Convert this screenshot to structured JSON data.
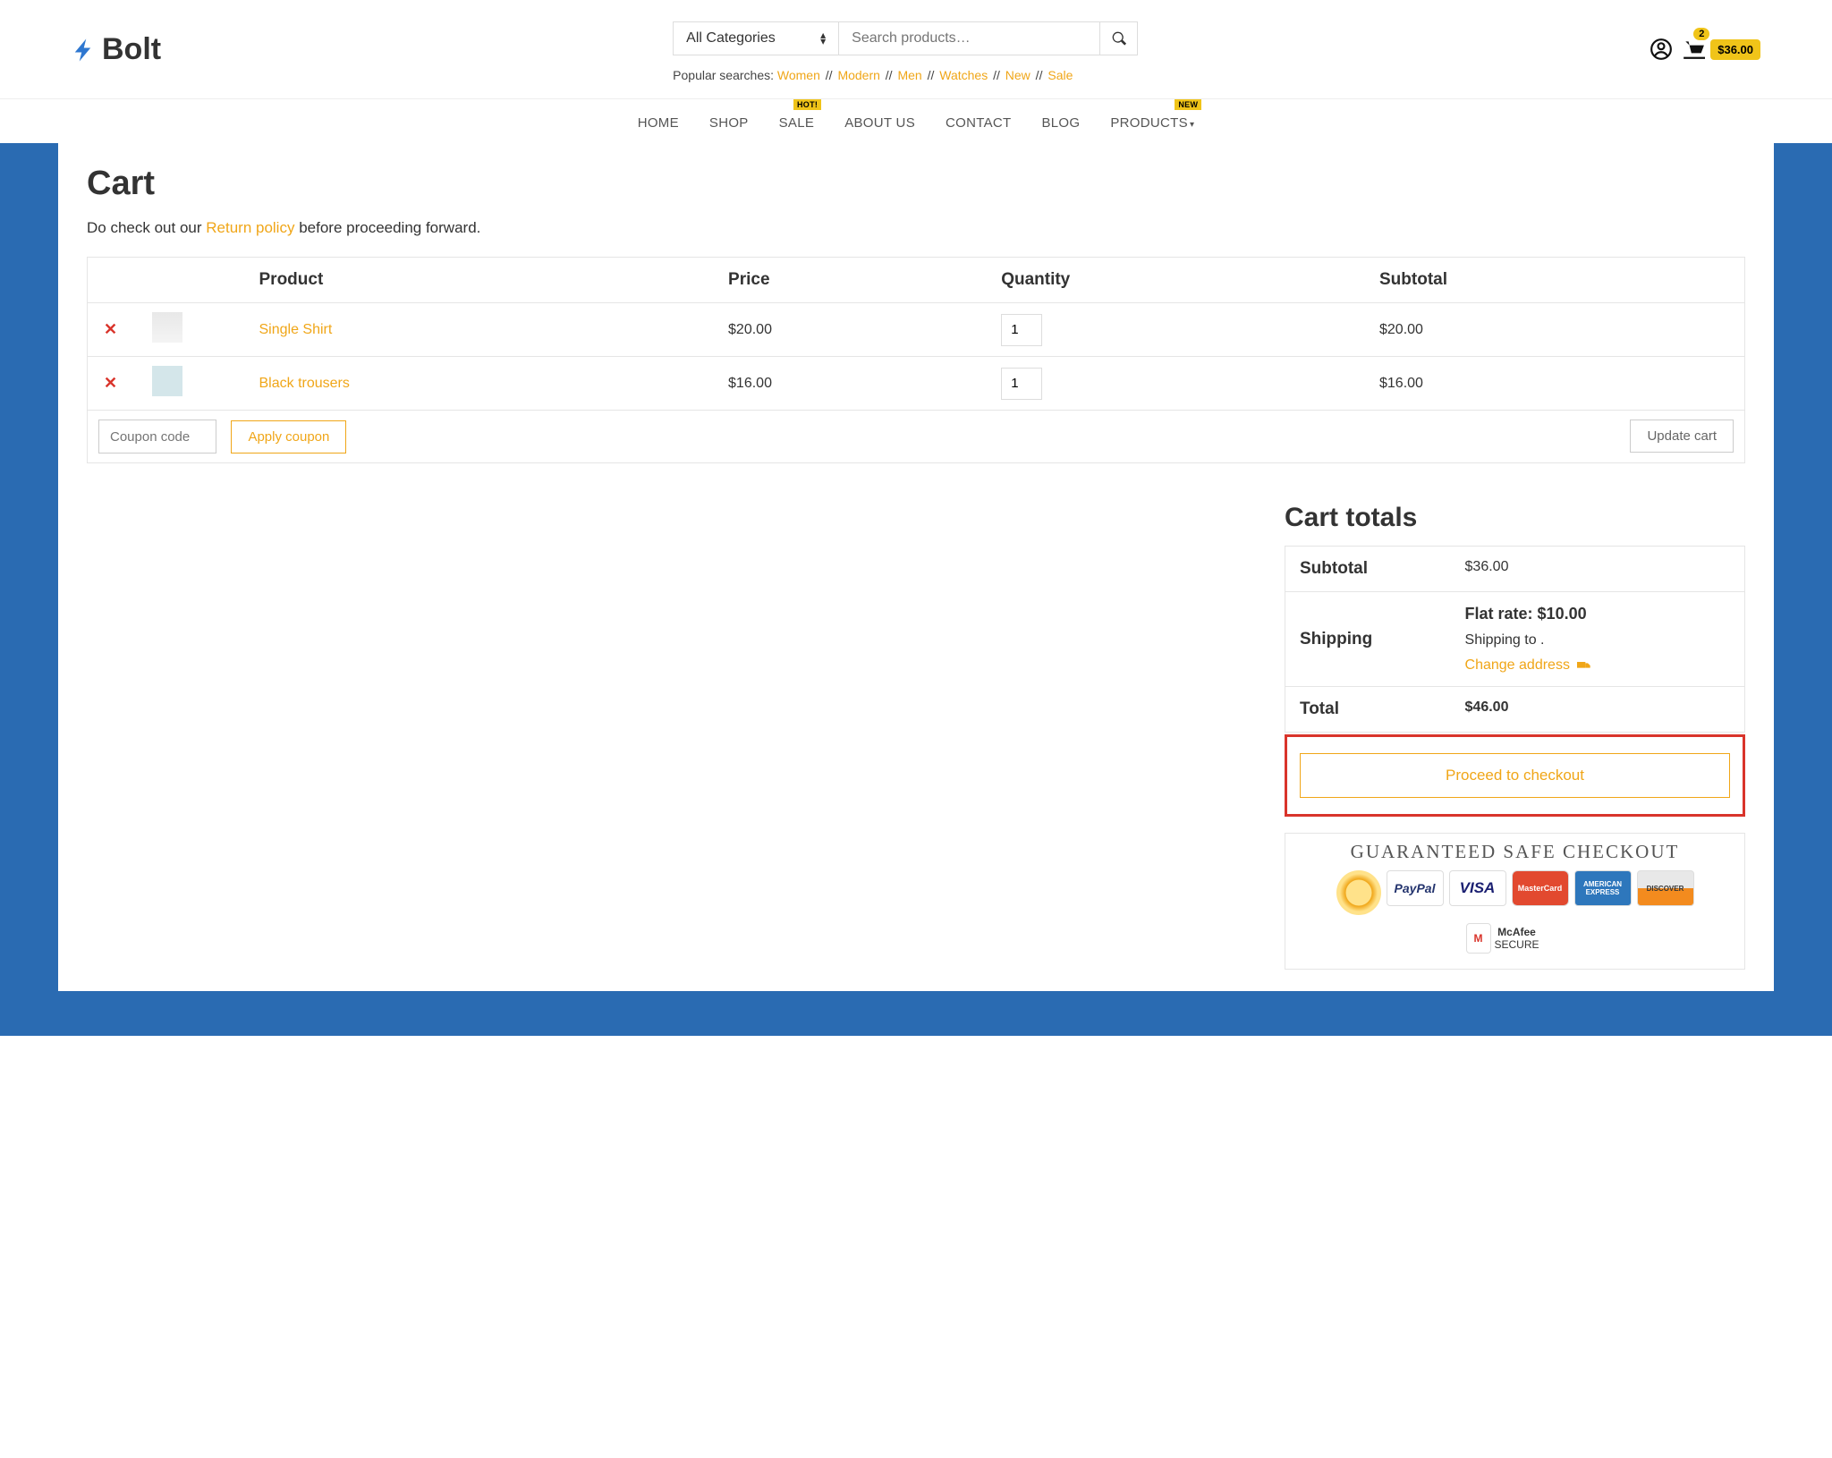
{
  "brand": "Bolt",
  "search": {
    "category_selected": "All Categories",
    "placeholder": "Search products…"
  },
  "popular": {
    "label": "Popular searches:",
    "links": [
      "Women",
      "Modern",
      "Men",
      "Watches",
      "New",
      "Sale"
    ]
  },
  "header_cart": {
    "count": "2",
    "total": "$36.00"
  },
  "nav": {
    "items": [
      "HOME",
      "SHOP",
      "SALE",
      "ABOUT US",
      "CONTACT",
      "BLOG",
      "PRODUCTS"
    ],
    "sale_tag": "HOT!",
    "products_tag": "NEW"
  },
  "page_title": "Cart",
  "intro": {
    "before": "Do check out our ",
    "link": "Return policy",
    "after": " before proceeding forward."
  },
  "table": {
    "headers": {
      "product": "Product",
      "price": "Price",
      "qty": "Quantity",
      "subtotal": "Subtotal"
    },
    "rows": [
      {
        "name": "Single Shirt",
        "price": "$20.00",
        "qty": "1",
        "subtotal": "$20.00"
      },
      {
        "name": "Black trousers",
        "price": "$16.00",
        "qty": "1",
        "subtotal": "$16.00"
      }
    ]
  },
  "coupon": {
    "placeholder": "Coupon code",
    "apply": "Apply coupon",
    "update": "Update cart"
  },
  "totals": {
    "title": "Cart totals",
    "subtotal_label": "Subtotal",
    "subtotal": "$36.00",
    "shipping_label": "Shipping",
    "flat_rate": "Flat rate: $10.00",
    "shipping_to": "Shipping to    .",
    "change_address": "Change address",
    "total_label": "Total",
    "total": "$46.00"
  },
  "checkout_btn": "Proceed to checkout",
  "safe": {
    "title": "GUARANTEED SAFE CHECKOUT",
    "badges": [
      "PayPal",
      "VISA",
      "MasterCard",
      "AMERICAN EXPRESS",
      "DISCOVER"
    ],
    "mcafee": "McAfee",
    "secure": "SECURE"
  }
}
